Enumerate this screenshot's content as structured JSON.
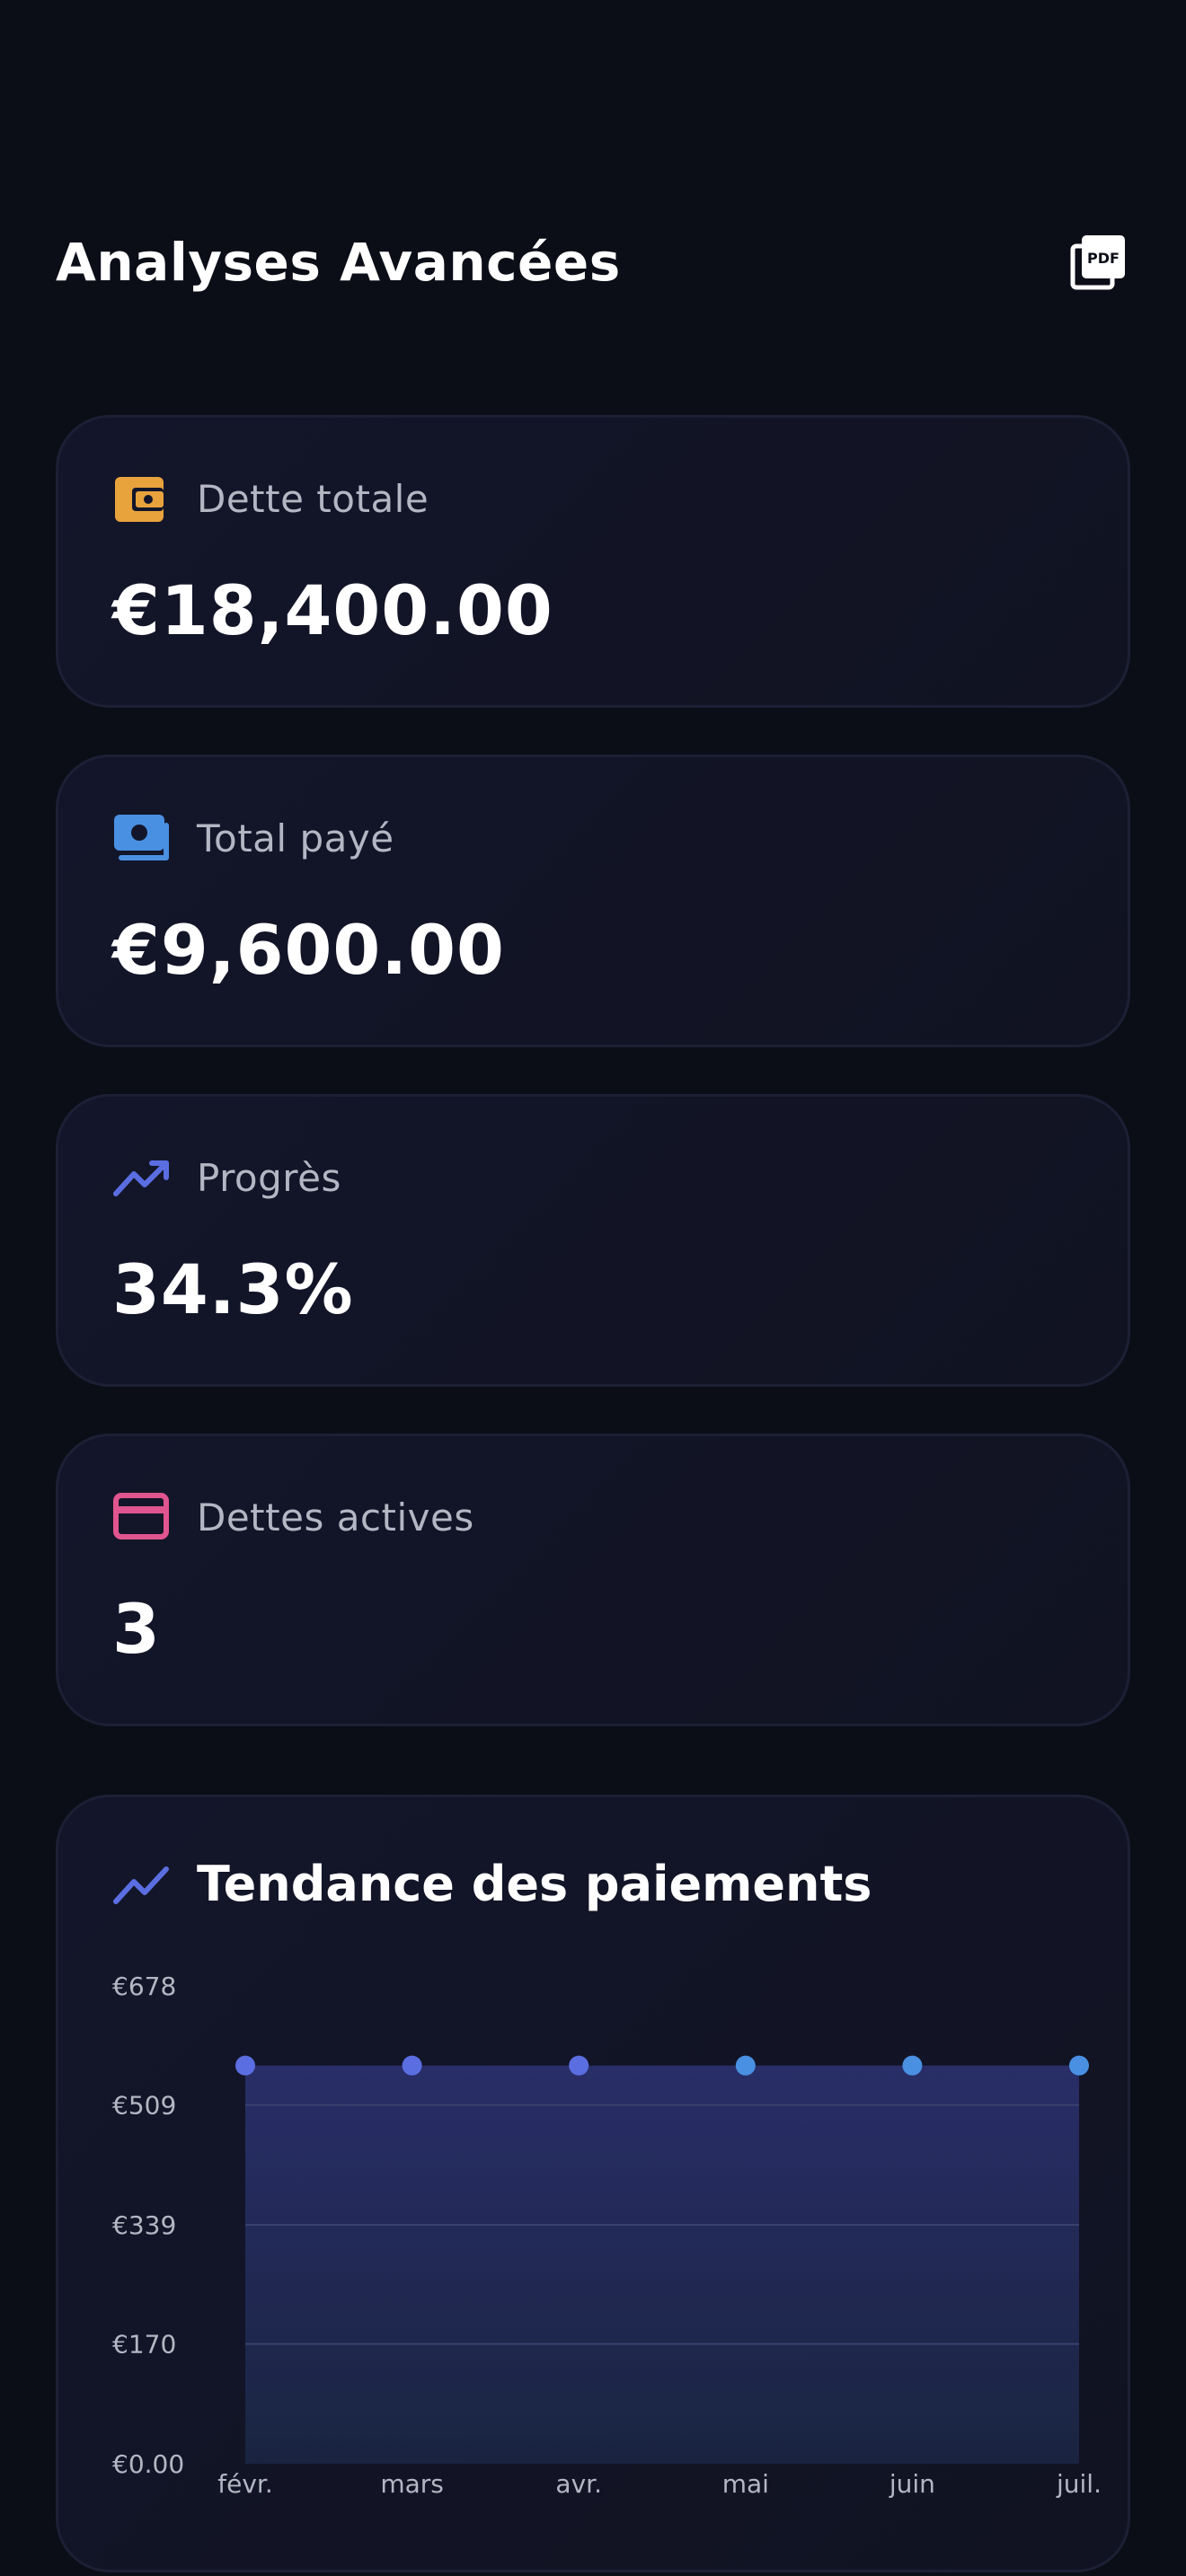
{
  "header": {
    "title": "Analyses Avancées",
    "pdf_icon": "pdf-export-icon"
  },
  "cards": [
    {
      "label": "Dette totale",
      "value": "€18,400.00",
      "icon": "wallet-icon",
      "color": "#e8a33d"
    },
    {
      "label": "Total payé",
      "value": "€9,600.00",
      "icon": "money-icon",
      "color": "#4a90e2"
    },
    {
      "label": "Progrès",
      "value": "34.3%",
      "icon": "trending-up-icon",
      "color": "#5b6ee1"
    },
    {
      "label": "Dettes actives",
      "value": "3",
      "icon": "credit-card-icon",
      "color": "#e0558f"
    }
  ],
  "chart": {
    "title": "Tendance des paiements",
    "icon": "trend-line-icon"
  },
  "chart_data": {
    "type": "area",
    "title": "Tendance des paiements",
    "categories": [
      "févr.",
      "mars",
      "avr.",
      "mai",
      "juin",
      "juil."
    ],
    "series": [
      {
        "values": [
          565,
          565,
          565,
          565,
          565,
          565
        ]
      }
    ],
    "y_ticks": [
      "€0.00",
      "€170",
      "€339",
      "€509",
      "€678"
    ],
    "y_tick_values": [
      0,
      170,
      339,
      509,
      678
    ],
    "ylim": [
      0,
      678
    ],
    "grid": true,
    "line_colors": [
      "#5b6ee1",
      "#4a90e2"
    ]
  }
}
